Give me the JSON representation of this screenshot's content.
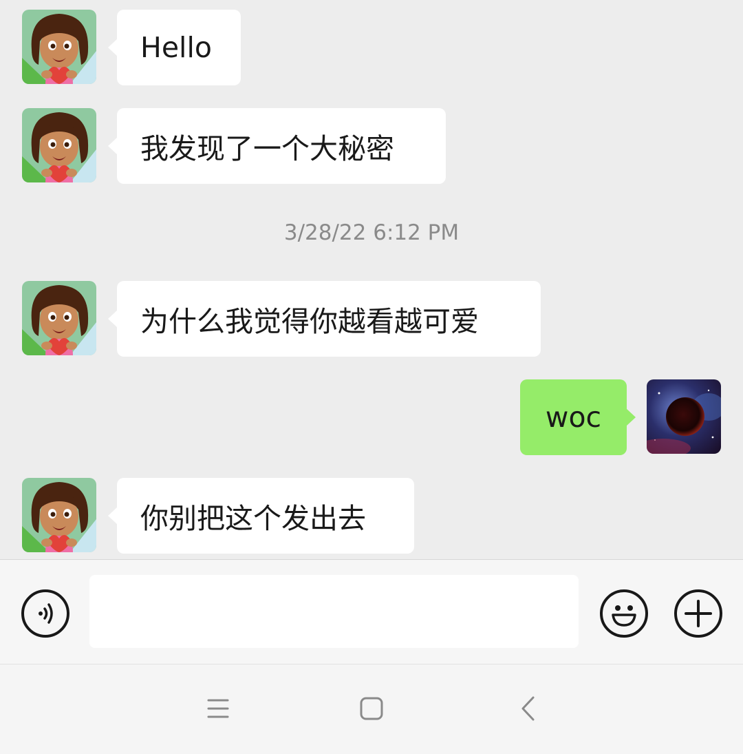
{
  "colors": {
    "background": "#ededed",
    "incoming_bubble": "#ffffff",
    "outgoing_bubble": "#95ec69",
    "timestamp_text": "#8a8a8a"
  },
  "messages": [
    {
      "direction": "incoming",
      "sender_avatar": "cartoon-girl-avatar",
      "text": "Hello"
    },
    {
      "direction": "incoming",
      "sender_avatar": "cartoon-girl-avatar",
      "text": "我发现了一个大秘密"
    },
    {
      "direction": "incoming",
      "sender_avatar": "cartoon-girl-avatar",
      "text": "为什么我觉得你越看越可爱"
    },
    {
      "direction": "outgoing",
      "sender_avatar": "galaxy-planet-avatar",
      "text": "woc"
    },
    {
      "direction": "incoming",
      "sender_avatar": "cartoon-girl-avatar",
      "text": "你别把这个发出去"
    }
  ],
  "timestamp": "3/28/22 6:12 PM",
  "input_bar": {
    "voice_icon": "voice-icon",
    "text_value": "",
    "emoji_icon": "emoji-icon",
    "plus_icon": "plus-icon"
  },
  "nav_bar": {
    "menu_icon": "menu-icon",
    "home_icon": "home-icon",
    "back_icon": "back-icon"
  }
}
